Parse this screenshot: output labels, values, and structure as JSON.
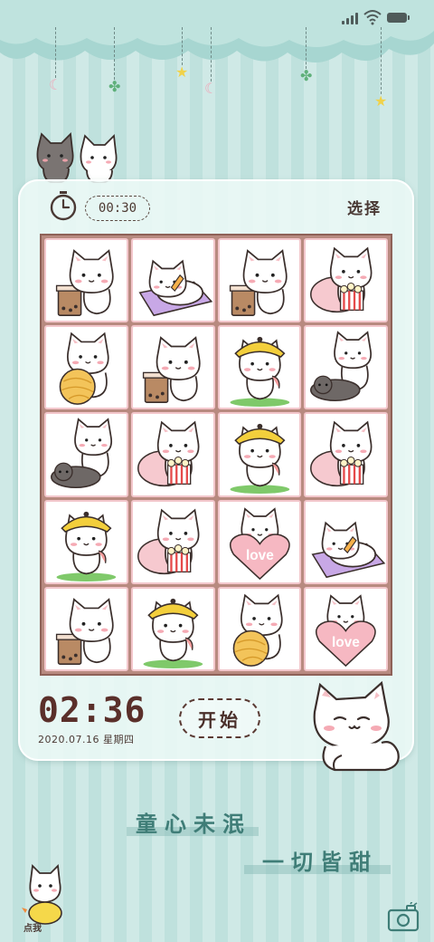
{
  "status_bar": {
    "signal_icon": "signal-icon",
    "wifi_icon": "wifi-icon",
    "battery_icon": "battery-icon"
  },
  "header": {
    "decorations": [
      "moon-icon",
      "leaf-icon",
      "star-icon",
      "moon-icon",
      "leaf-icon",
      "star-icon"
    ]
  },
  "game": {
    "timer_value": "00:30",
    "select_label": "选择",
    "tiles": [
      "cat-milk-tea",
      "cat-lying-pillow",
      "cat-milk-tea",
      "cat-popcorn",
      "cat-yarn-ball",
      "cat-milk-tea",
      "cat-yellow-hat",
      "cat-gray-friend",
      "cat-gray-friend",
      "cat-popcorn",
      "cat-yellow-hat",
      "cat-popcorn",
      "cat-yellow-hat",
      "cat-popcorn",
      "cat-love-heart",
      "cat-lying-pillow",
      "cat-milk-tea",
      "cat-yellow-hat",
      "cat-yarn-ball",
      "cat-love-heart"
    ],
    "love_text": "love",
    "start_label": "开始"
  },
  "clock": {
    "time": "02:36",
    "date": "2020.07.16 星期四"
  },
  "slogan": {
    "line1": "童心未泯",
    "line2": "一切皆甜"
  },
  "bottom": {
    "dianwo_label": "点我",
    "camera_icon": "camera-icon"
  },
  "colors": {
    "background": "#c8e6e2",
    "tile_border": "#f3c7cc",
    "board": "#b88a80",
    "text_dark": "#5a2f2a",
    "slogan": "#3f7d77"
  }
}
